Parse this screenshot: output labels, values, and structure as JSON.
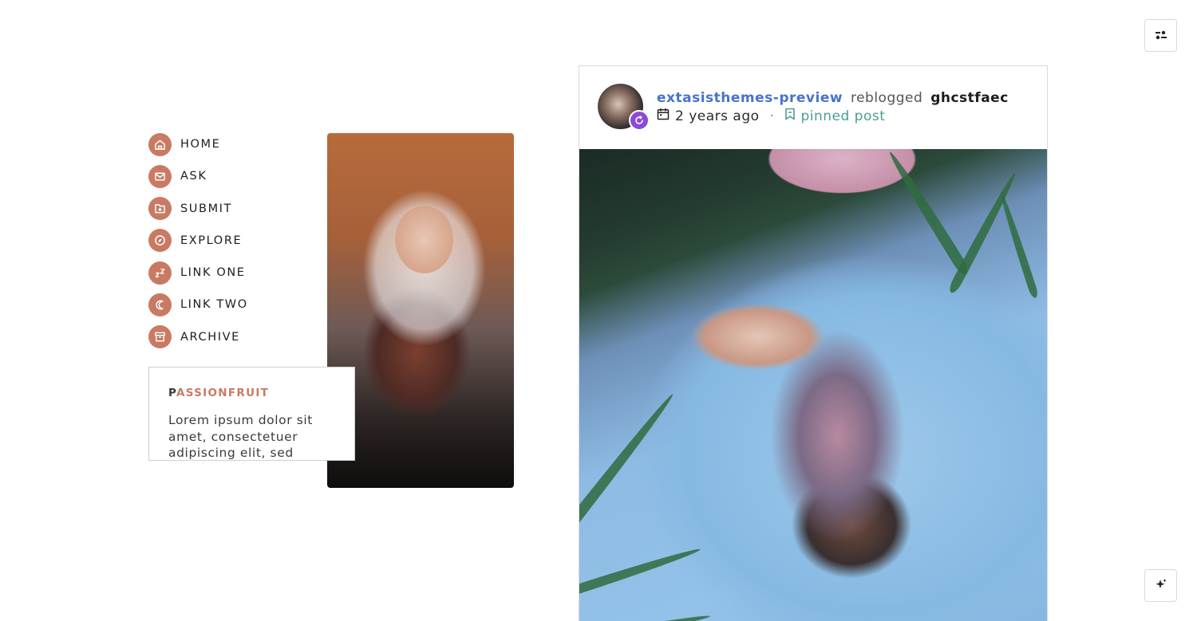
{
  "toolbar": {
    "top_icon": "customize-sliders-icon",
    "bottom_icon": "sparkles-icon"
  },
  "nav": {
    "items": [
      {
        "label": "HOME",
        "icon": "home-icon"
      },
      {
        "label": "ASK",
        "icon": "mail-icon"
      },
      {
        "label": "SUBMIT",
        "icon": "submit-folder-icon"
      },
      {
        "label": "EXPLORE",
        "icon": "compass-icon"
      },
      {
        "label": "LINK ONE",
        "icon": "zzz-icon"
      },
      {
        "label": "LINK TWO",
        "icon": "moon-icon"
      },
      {
        "label": "ARCHIVE",
        "icon": "archive-box-icon"
      }
    ]
  },
  "bio": {
    "title_first": "P",
    "title_rest": "ASSIONFRUIT",
    "text": "Lorem ipsum dolor sit amet, consectetuer adipiscing elit, sed"
  },
  "post": {
    "author": "extasisthemes-preview",
    "action": "reblogged",
    "source": "ghcstfaec",
    "time": "2 years ago",
    "separator": "·",
    "pinned": "pinned post"
  },
  "colors": {
    "accent": "#c97a63",
    "author_link": "#4873c9",
    "pinned": "#4c9c96",
    "badge": "#8b4bd8"
  }
}
